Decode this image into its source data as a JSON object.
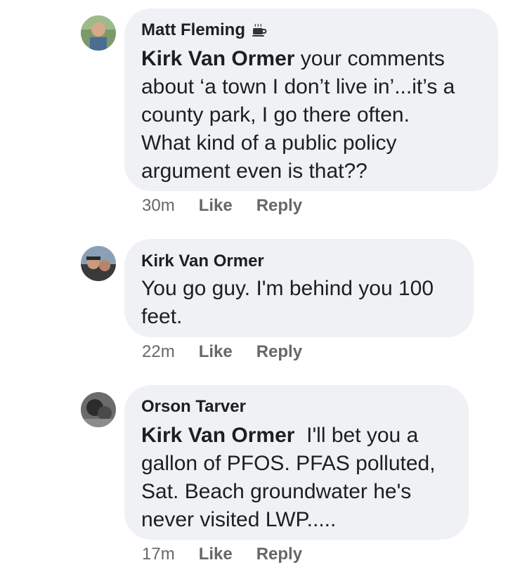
{
  "comments": [
    {
      "author": "Matt Fleming",
      "badge_icon": "coffee-cup-icon",
      "mention": "Kirk Van Ormer",
      "body_lines": [
        " your comments",
        "about ‘a town I don’t live in’...it’s a",
        "county park, I go there often.",
        "What kind of a public policy",
        "argument even is that??"
      ],
      "time": "30m",
      "like_label": "Like",
      "reply_label": "Reply"
    },
    {
      "author": "Kirk Van Ormer",
      "mention": "",
      "body_lines": [
        "You go guy. I'm behind you 100",
        "feet."
      ],
      "time": "22m",
      "like_label": "Like",
      "reply_label": "Reply"
    },
    {
      "author": "Orson Tarver",
      "mention": "Kirk Van Ormer",
      "body_lines": [
        "  I'll bet you a",
        "gallon of PFOS. PFAS polluted,",
        "Sat. Beach groundwater he's",
        "never visited LWP....."
      ],
      "time": "17m",
      "like_label": "Like",
      "reply_label": "Reply"
    }
  ]
}
